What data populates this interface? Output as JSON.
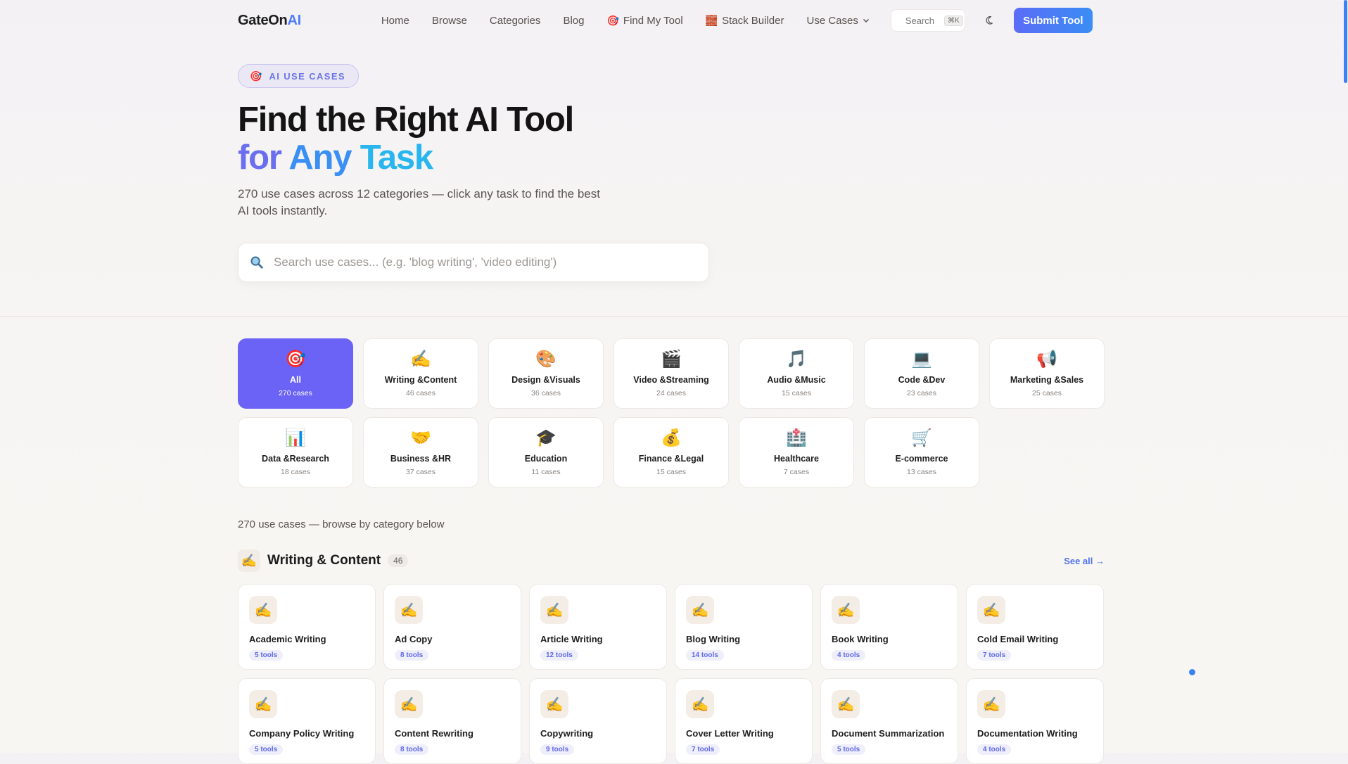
{
  "header": {
    "logo_main": "GateOn",
    "logo_accent": "AI",
    "nav": [
      {
        "label": "Home",
        "icon": ""
      },
      {
        "label": "Browse",
        "icon": ""
      },
      {
        "label": "Categories",
        "icon": ""
      },
      {
        "label": "Blog",
        "icon": ""
      },
      {
        "label": "Find My Tool",
        "icon": "🎯"
      },
      {
        "label": "Stack Builder",
        "icon": "🧱"
      },
      {
        "label": "Use Cases",
        "icon": ""
      }
    ],
    "search_label": "Search",
    "search_shortcut": "⌘K",
    "submit_label": "Submit Tool"
  },
  "hero": {
    "badge_icon": "🎯",
    "badge_text": "AI USE CASES",
    "title_line1": "Find the Right AI Tool",
    "title_line2_a": "for ",
    "title_line2_b": "Any ",
    "title_line2_c": "Task",
    "lead": "270 use cases across 12 categories — click any task to find the best AI tools instantly.",
    "search_placeholder": "Search use cases... (e.g. 'blog writing', 'video editing')"
  },
  "categories": [
    {
      "icon": "🎯",
      "name": "All",
      "count": "270 cases",
      "active": true
    },
    {
      "icon": "✍️",
      "name": "Writing &Content",
      "count": "46 cases"
    },
    {
      "icon": "🎨",
      "name": "Design &Visuals",
      "count": "36 cases"
    },
    {
      "icon": "🎬",
      "name": "Video &Streaming",
      "count": "24 cases"
    },
    {
      "icon": "🎵",
      "name": "Audio &Music",
      "count": "15 cases"
    },
    {
      "icon": "💻",
      "name": "Code &Dev",
      "count": "23 cases"
    },
    {
      "icon": "📢",
      "name": "Marketing &Sales",
      "count": "25 cases"
    },
    {
      "icon": "📊",
      "name": "Data &Research",
      "count": "18 cases"
    },
    {
      "icon": "🤝",
      "name": "Business &HR",
      "count": "37 cases"
    },
    {
      "icon": "🎓",
      "name": "Education",
      "count": "11 cases"
    },
    {
      "icon": "💰",
      "name": "Finance &Legal",
      "count": "15 cases"
    },
    {
      "icon": "🏥",
      "name": "Healthcare",
      "count": "7 cases"
    },
    {
      "icon": "🛒",
      "name": "E-commerce",
      "count": "13 cases"
    }
  ],
  "summary": "270 use cases — browse by category below",
  "section": {
    "icon": "✍️",
    "title": "Writing & Content",
    "count": "46",
    "see_all": "See all →"
  },
  "use_cases": [
    {
      "title": "Academic Writing",
      "tools": "5 tools"
    },
    {
      "title": "Ad Copy",
      "tools": "8 tools"
    },
    {
      "title": "Article Writing",
      "tools": "12 tools"
    },
    {
      "title": "Blog Writing",
      "tools": "14 tools"
    },
    {
      "title": "Book Writing",
      "tools": "4 tools"
    },
    {
      "title": "Cold Email Writing",
      "tools": "7 tools"
    },
    {
      "title": "Company Policy Writing",
      "tools": "5 tools"
    },
    {
      "title": "Content Rewriting",
      "tools": "8 tools"
    },
    {
      "title": "Copywriting",
      "tools": "9 tools"
    },
    {
      "title": "Cover Letter Writing",
      "tools": "7 tools"
    },
    {
      "title": "Document Summarization",
      "tools": "5 tools"
    },
    {
      "title": "Documentation Writing",
      "tools": "4 tools"
    }
  ],
  "use_case_icon": "✍️",
  "colors": {
    "accent": "#6b63f5",
    "brand_blue": "#3a8df5",
    "title_gradient": [
      "#6a6ff0",
      "#3a8ff5",
      "#29b5ee"
    ]
  }
}
